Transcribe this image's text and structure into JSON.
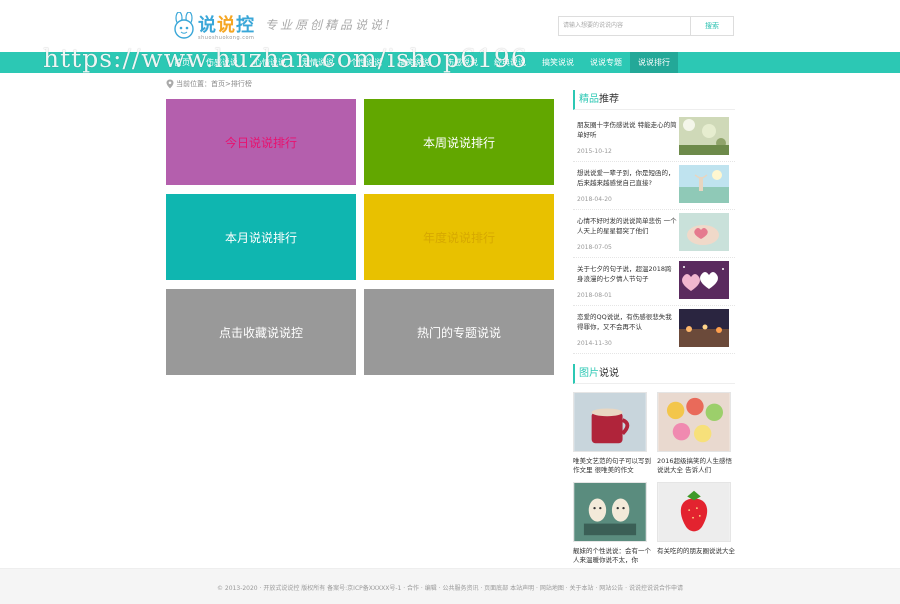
{
  "header": {
    "logo_text_a": "说",
    "logo_text_b": "说",
    "logo_text_c": "控",
    "logo_sub": "shuoshuokong.com",
    "slogan": "专业原创精品说说!",
    "search_placeholder": "请输入想要的说说内容",
    "search_button": "搜索"
  },
  "nav": {
    "items": [
      {
        "label": "首页"
      },
      {
        "label": "伤感说说"
      },
      {
        "label": "心情说说"
      },
      {
        "label": "爱情说说"
      },
      {
        "label": "个性说说"
      },
      {
        "label": "搞笑说说"
      },
      {
        "label": "伤感说说"
      },
      {
        "label": "经典说说"
      },
      {
        "label": "搞笑说说"
      },
      {
        "label": "说说专题"
      },
      {
        "label": "说说排行"
      }
    ],
    "watermark": "https://www.huzhan.com/ishop6196"
  },
  "breadcrumb": {
    "current_label": "当前位置：",
    "home": "首页",
    "sep": " > ",
    "page": "排行榜"
  },
  "tiles": [
    {
      "label": "今日说说排行"
    },
    {
      "label": "本周说说排行"
    },
    {
      "label": "本月说说排行"
    },
    {
      "label": "年度说说排行"
    },
    {
      "label": "点击收藏说说控"
    },
    {
      "label": "热门的专题说说"
    }
  ],
  "sidebar": {
    "rec_title_accent": "精品",
    "rec_title_rest": "推荐",
    "rec_items": [
      {
        "text": "朋友圈十字伤感说说 特能走心的简单好听",
        "date": "2015-10-12"
      },
      {
        "text": "想说说爱一辈子到，你是短函的，后来越来越感觉自己直接?",
        "date": "2018-04-20"
      },
      {
        "text": "心情不好时发的说说简单悲伤 一个人天上的星星都突了他们",
        "date": "2018-07-05"
      },
      {
        "text": "关于七夕的句子说，超温2018跨身浪漫的七夕情人节句子",
        "date": "2018-08-01"
      },
      {
        "text": "恋爱的QQ说说，有伤感很悲失我得罪你，又不会再不认",
        "date": "2014-11-30"
      }
    ],
    "pic_title_accent": "图片",
    "pic_title_rest": "说说",
    "pic_items": [
      {
        "caption": "唯美文艺范的句子可以写到作文里 很唯美的作文"
      },
      {
        "caption": "2016超级搞笑的人生感悟说说大全 告诉人们"
      },
      {
        "caption": "靓妹的个性说说：会有一个人来温暖你说不太，你"
      },
      {
        "caption": "有关吃的的朋友圈说说大全"
      }
    ]
  },
  "footer": {
    "text": "© 2013-2020 · 开放式说说控 版权所有 备案号:京ICP备XXXXX号-1 · 合作 · 编辑 · 公共服务资讯 · 页面底部        本站声明 · 网站地图 · 关于本站 · 网站公告 · 说说控说说合作申请"
  },
  "colors": {
    "brand": "#2cc8b4",
    "nav_active": "#23a898",
    "tile_purple": "#b45fad",
    "tile_green": "#62a700",
    "tile_teal": "#0fb6b0",
    "tile_yellow": "#e8c100",
    "tile_grey": "#999999"
  }
}
